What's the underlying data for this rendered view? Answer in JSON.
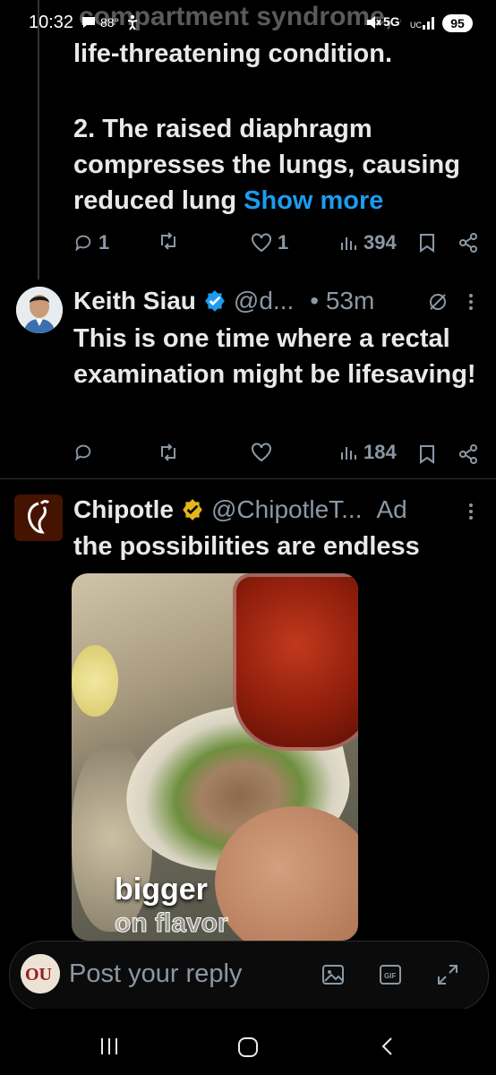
{
  "status_bar": {
    "time": "10:32",
    "temperature": "88°",
    "network": "5G",
    "battery": "95"
  },
  "previous_tweet": {
    "behind_status_text": "compartment syndrome, a",
    "text_line1": "life-threatening condition.",
    "text_para2": "2. The raised diaphragm compresses the lungs, causing reduced lung",
    "show_more": "Show more",
    "replies": "1",
    "likes": "1",
    "views": "394"
  },
  "reply_tweet": {
    "name": "Keith Siau",
    "handle": "@d...",
    "time": "• 53m",
    "text": "This is one time where a rectal examination might be lifesaving!",
    "views": "184"
  },
  "ad_tweet": {
    "name": "Chipotle",
    "handle": "@ChipotleT...",
    "ad_label": "Ad",
    "text": "the possibilities are endless",
    "media_caption_line1": "bigger",
    "media_caption_line2": "on flavor"
  },
  "reply_bar": {
    "placeholder": "Post your reply"
  },
  "colors": {
    "background": "#000000",
    "text": "#e7e9ea",
    "muted": "#8b98a5",
    "link": "#1d9bf0",
    "verified_blue": "#1d9bf0",
    "verified_gold": "#e2b719",
    "chipotle_brand": "#451400"
  }
}
